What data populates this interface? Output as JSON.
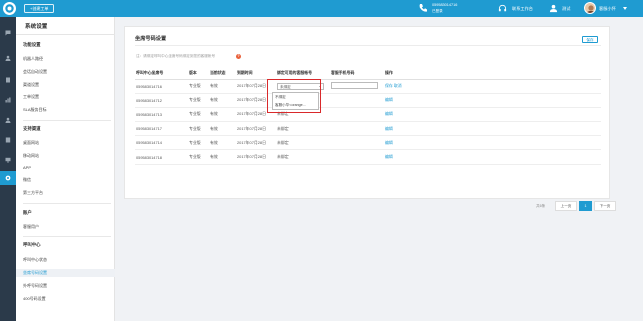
{
  "topbar": {
    "new_ticket_label": "+创建工单",
    "phone_number": "059583014716",
    "phone_status": "已登录",
    "workbench_label": "联系工作台",
    "test_label": "测试",
    "user_name": "客服小怀"
  },
  "sidebar": {
    "title": "系统设置",
    "groups": [
      {
        "title": "功能设置",
        "items": [
          "机器人路径",
          "会话自动设置",
          "渠道设置",
          "工单设置",
          "SLA服务目标"
        ]
      },
      {
        "title": "支持渠道",
        "items": [
          "桌面网站",
          "移动网站",
          "APP",
          "微信",
          "第三方平台"
        ]
      },
      {
        "title": "账户",
        "items": [
          "客服用户"
        ]
      },
      {
        "title": "呼叫中心",
        "items": [
          "呼叫中心状态",
          "坐席号码设置",
          "外呼号码设置",
          "400号码设置"
        ]
      }
    ],
    "active_item": "坐席号码设置"
  },
  "main": {
    "title": "坐席号码设置",
    "save_label": "保存",
    "tip": "注：请绑定呼叫中心坐席号码绑定到您的客服帐号",
    "tip_icon": "?",
    "columns": [
      "呼叫中心坐席号",
      "版本",
      "当前状态",
      "到期时间",
      "绑定可用的客服帐号",
      "客服手机号码",
      "操作"
    ],
    "rows": [
      {
        "number": "059583014716",
        "version": "专业版",
        "status": "有效",
        "expire": "2017年07月28日",
        "bound": "未绑定",
        "ops": "保存 取消"
      },
      {
        "number": "059583014712",
        "version": "专业版",
        "status": "有效",
        "expire": "2017年07月28日",
        "bound": "",
        "ops": "编辑"
      },
      {
        "number": "059583014713",
        "version": "专业版",
        "status": "有效",
        "expire": "2017年07月28日",
        "bound": "未绑定",
        "ops": "编辑"
      },
      {
        "number": "059583014717",
        "version": "专业版",
        "status": "有效",
        "expire": "2017年07月28日",
        "bound": "未绑定",
        "ops": "编辑"
      },
      {
        "number": "059583014714",
        "version": "专业版",
        "status": "有效",
        "expire": "2017年07月28日",
        "bound": "未绑定",
        "ops": "编辑"
      },
      {
        "number": "059583014718",
        "version": "专业版",
        "status": "有效",
        "expire": "2017年07月28日",
        "bound": "未绑定",
        "ops": "编辑"
      }
    ],
    "dropdown_options": [
      "不绑定",
      "客服小华<orange..."
    ],
    "pagination": {
      "total": "共6条",
      "prev": "上一页",
      "current": "1",
      "next": "下一页"
    }
  },
  "colors": {
    "accent": "#1f9bd1",
    "rail": "#2b3a4a",
    "highlight": "#d9292b"
  }
}
